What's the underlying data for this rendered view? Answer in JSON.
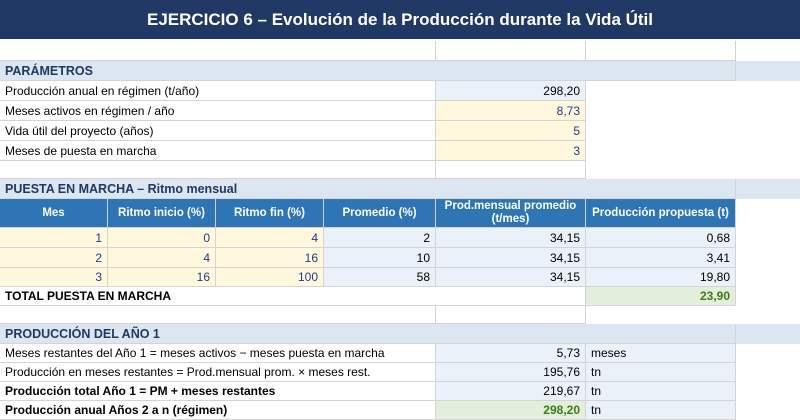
{
  "title": "EJERCICIO 6 – Evolución de la Producción durante la Vida Útil",
  "params": {
    "heading": "PARÁMETROS",
    "rows": [
      {
        "label": "Producción anual en régimen (t/año)",
        "value": "298,20"
      },
      {
        "label": "Meses activos en régimen / año",
        "value": "8,73"
      },
      {
        "label": "Vida útil del proyecto (años)",
        "value": "5"
      },
      {
        "label": "Meses de puesta en marcha",
        "value": "3"
      }
    ]
  },
  "puesta": {
    "heading": "PUESTA EN MARCHA – Ritmo mensual",
    "headers": [
      "Mes",
      "Ritmo inicio (%)",
      "Ritmo fin (%)",
      "Promedio (%)",
      "Prod.mensual promedio (t/mes)",
      "Producción propuesta (t)"
    ],
    "rows": [
      [
        "1",
        "0",
        "4",
        "2",
        "34,15",
        "0,68"
      ],
      [
        "2",
        "4",
        "16",
        "10",
        "34,15",
        "3,41"
      ],
      [
        "3",
        "16",
        "100",
        "58",
        "34,15",
        "19,80"
      ]
    ],
    "total_label": "TOTAL PUESTA EN MARCHA",
    "total_value": "23,90"
  },
  "anio1": {
    "heading": "PRODUCCIÓN DEL AÑO 1",
    "rows": [
      {
        "label": "Meses restantes del Año 1 = meses activos − meses puesta en marcha",
        "value": "5,73",
        "unit": "meses"
      },
      {
        "label": "Producción en meses restantes = Prod.mensual prom. × meses rest.",
        "value": "195,76",
        "unit": "tn"
      },
      {
        "label": "Producción total Año 1  = PM + meses restantes",
        "value": "219,67",
        "unit": "tn"
      },
      {
        "label": "Producción anual Años 2 a n (régimen)",
        "value": "298,20",
        "unit": "tn"
      }
    ]
  }
}
